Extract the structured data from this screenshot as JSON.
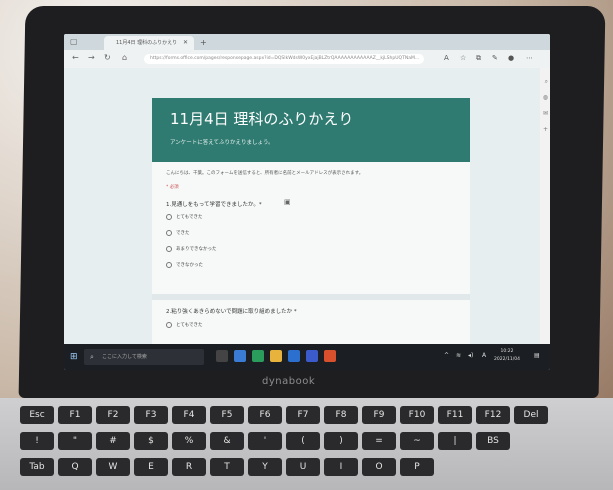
{
  "browser": {
    "tab_title": "11月4日 理科のふりかえり",
    "url": "https://forms.office.com/pages/responsepage.aspx?id=DQSIkWdsW0yxEjajBLZtrQAAAAAAAAAAAAZ__kjLShpUQTNaM..."
  },
  "form": {
    "title": "11月4日 理科のふりかえり",
    "subtitle": "アンケートに答えてふりかえりましょう。",
    "notice": "こんにちは、千葉。このフォームを送信すると、所有者に名前とメールアドレスが表示されます。",
    "required_label": "* 必須",
    "q1": "1.見通しをもって学習できましたか。*",
    "q1_options": [
      "とてもできた",
      "できた",
      "あまりできなかった",
      "できなかった"
    ],
    "q2": "2.粘り強くあきらめないで問題に取り組めましたか *",
    "q2_options": [
      "とてもできた"
    ]
  },
  "taskbar": {
    "search_placeholder": "ここに入力して検索",
    "time": "10:22",
    "date": "2022/11/04"
  },
  "device": {
    "brand": "dynabook"
  },
  "keyboard": {
    "row1": [
      "Esc",
      "F1",
      "F2",
      "F3",
      "F4",
      "F5",
      "F6",
      "F7",
      "F8",
      "F9",
      "F10",
      "F11",
      "F12",
      "Del"
    ],
    "row2": [
      "!",
      "\"",
      "#",
      "$",
      "%",
      "&",
      "'",
      "(",
      ")",
      "=",
      "~",
      "|",
      "BS"
    ],
    "row3": [
      "Tab",
      "Q",
      "W",
      "E",
      "R",
      "T",
      "Y",
      "U",
      "I",
      "O",
      "P"
    ]
  }
}
